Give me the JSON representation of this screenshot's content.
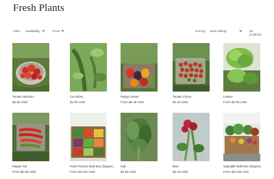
{
  "page": {
    "title": "Fresh Plants"
  },
  "filters": {
    "label": "Filter:",
    "availability": "Availability",
    "price": "Price",
    "sort_label": "Sort by:",
    "sort_value": "Best selling",
    "count": "32 products"
  },
  "products": [
    {
      "name": "Tomato Heirloom",
      "price": "$3.99 USD"
    },
    {
      "name": "Cucumber",
      "price": "$1.99 USD"
    },
    {
      "name": "Pepper Sweet",
      "price": "From $0.49 USD"
    },
    {
      "name": "Tomato Cherry",
      "price": "$4.40 USD"
    },
    {
      "name": "Lettuce",
      "price": "From $3.99 USD"
    },
    {
      "name": "Pepper Hot",
      "price": "From $0.99 USD"
    },
    {
      "name": "Fresh Produce Bulk Box (Organic)",
      "price": "From $16.55 USD"
    },
    {
      "name": "Kale",
      "price": "$3.99 USD"
    },
    {
      "name": "Beet",
      "price": "$2.49 USD"
    },
    {
      "name": "Vegetable Bulk Box (Organic)",
      "price": "From $14.66 USD"
    }
  ]
}
